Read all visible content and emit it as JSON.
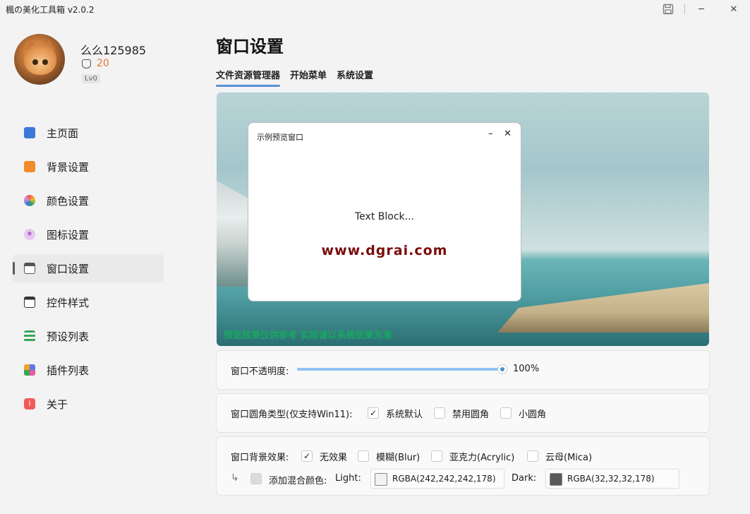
{
  "app": {
    "title": "楓の美化工具箱 v2.0.2"
  },
  "titlebar": {
    "save_icon": "save-icon",
    "minimize": "─",
    "close": "✕"
  },
  "user": {
    "name": "么么125985",
    "coins": "20",
    "level": "Lv0"
  },
  "nav": {
    "items": [
      {
        "label": "主页面",
        "icon": "home-icon",
        "color": "#3c78d8"
      },
      {
        "label": "背景设置",
        "icon": "image-icon",
        "color": "#f28b2c"
      },
      {
        "label": "颜色设置",
        "icon": "palette-icon",
        "color": "#e85a9a"
      },
      {
        "label": "图标设置",
        "icon": "star-icon",
        "color": "#d88ae0"
      },
      {
        "label": "窗口设置",
        "icon": "window-icon",
        "color": "#555555",
        "active": true
      },
      {
        "label": "控件样式",
        "icon": "controls-icon",
        "color": "#333333"
      },
      {
        "label": "预设列表",
        "icon": "list-icon",
        "color": "#3aa55a"
      },
      {
        "label": "插件列表",
        "icon": "plugin-icon",
        "color": "#5a7ae8"
      },
      {
        "label": "关于",
        "icon": "info-icon",
        "color": "#f25a5a"
      }
    ]
  },
  "main": {
    "title": "窗口设置",
    "tabs": [
      {
        "label": "文件资源管理器",
        "active": true
      },
      {
        "label": "开始菜单"
      },
      {
        "label": "系统设置"
      }
    ],
    "preview": {
      "window_title": "示例预览窗口",
      "minimize": "–",
      "close": "✕",
      "text_block": "Text Block...",
      "watermark": "www.dgrai.com",
      "note": "预览效果仅供参考 实际请以系统效果为准"
    },
    "opacity": {
      "label": "窗口不透明度:",
      "value": "100%",
      "level": 1.0
    },
    "corner": {
      "label": "窗口圆角类型(仅支持Win11):",
      "options": [
        {
          "label": "系统默认",
          "checked": true
        },
        {
          "label": "禁用圆角",
          "checked": false
        },
        {
          "label": "小圆角",
          "checked": false
        }
      ]
    },
    "background": {
      "label": "窗口背景效果:",
      "options": [
        {
          "label": "无效果",
          "checked": true
        },
        {
          "label": "模糊(Blur)",
          "checked": false
        },
        {
          "label": "亚克力(Acrylic)",
          "checked": false
        },
        {
          "label": "云母(Mica)",
          "checked": false
        }
      ],
      "blend_label": "添加混合颜色:",
      "light_label": "Light:",
      "light_value": "RGBA(242,242,242,178)",
      "light_color": "#f2f2f2",
      "dark_label": "Dark:",
      "dark_value": "RGBA(32,32,32,178)",
      "dark_color": "#5a5a5a"
    }
  }
}
